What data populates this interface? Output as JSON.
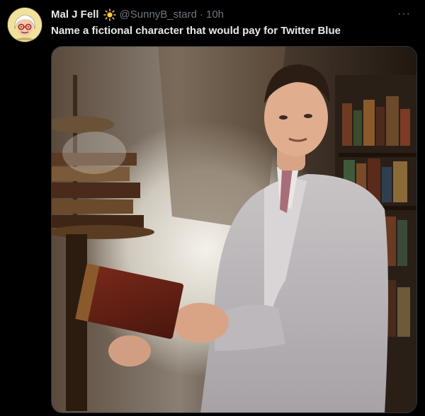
{
  "tweet": {
    "author": {
      "display_name": "Mal J Fell",
      "emoji_icon": "sun-icon",
      "handle": "@SunnyB_stard",
      "separator": "·",
      "time": "10h"
    },
    "more_icon": "more-icon",
    "text": "Name a fictional character that would pay for Twitter Blue",
    "media": {
      "type": "photo",
      "icon": "photo-man-in-grey-suit-holding-book"
    }
  }
}
